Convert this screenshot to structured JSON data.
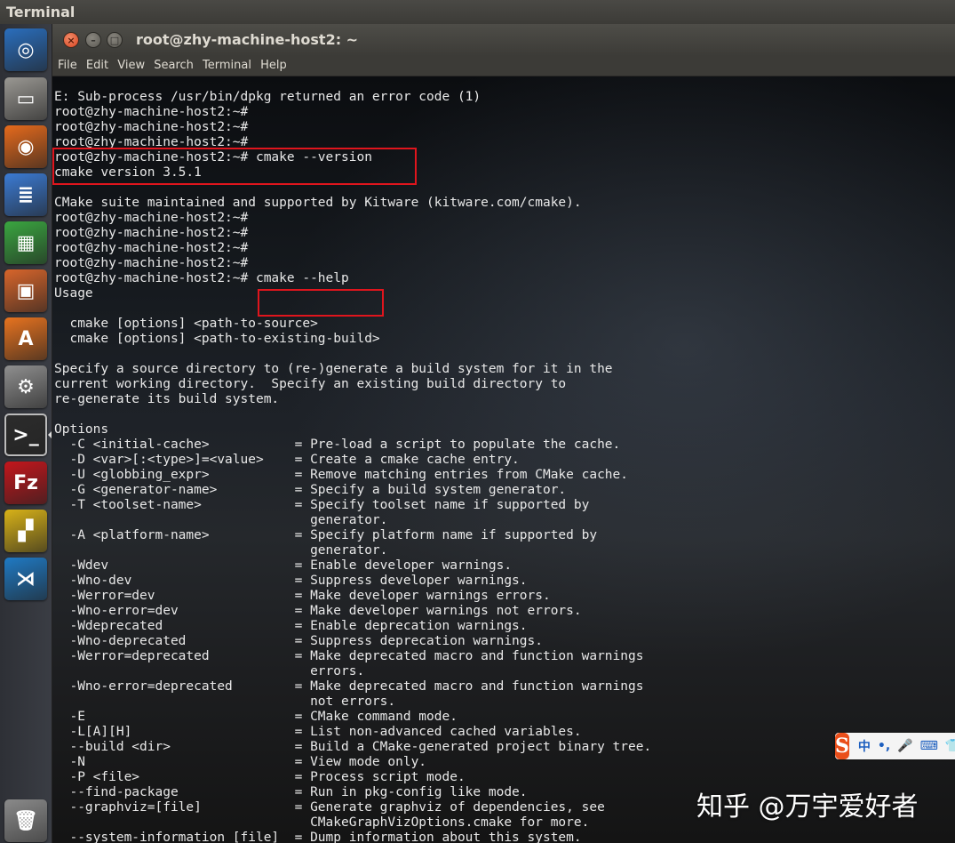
{
  "top_panel": {
    "title": "Terminal"
  },
  "launcher": {
    "items": [
      {
        "name": "ubuntu-dash-icon",
        "glyph": "◎",
        "color": "#2a6ebd"
      },
      {
        "name": "files-icon",
        "glyph": "▭",
        "color": "#9a9893"
      },
      {
        "name": "firefox-icon",
        "glyph": "◉",
        "color": "#e66a1c"
      },
      {
        "name": "writer-icon",
        "glyph": "≣",
        "color": "#3b7bd4"
      },
      {
        "name": "calc-icon",
        "glyph": "▦",
        "color": "#3aa640"
      },
      {
        "name": "impress-icon",
        "glyph": "▣",
        "color": "#d8652b"
      },
      {
        "name": "software-center-icon",
        "glyph": "A",
        "color": "#e8731f"
      },
      {
        "name": "settings-icon",
        "glyph": "⚙",
        "color": "#8f8f8f"
      },
      {
        "name": "terminal-icon",
        "glyph": ">_",
        "color": "#2c2c2c"
      },
      {
        "name": "filezilla-icon",
        "glyph": "Fz",
        "color": "#c4161c"
      },
      {
        "name": "multicolor-app-icon",
        "glyph": "▞",
        "color": "#d8b218"
      },
      {
        "name": "vscode-icon",
        "glyph": "⋊",
        "color": "#1f7ac4"
      }
    ],
    "trash": {
      "name": "trash-icon",
      "glyph": "🗑",
      "color": "#8a8a8a"
    }
  },
  "window": {
    "title": "root@zhy-machine-host2: ~",
    "buttons": {
      "close": "×",
      "minimize": "–",
      "maximize": "□"
    }
  },
  "menubar": [
    "File",
    "Edit",
    "View",
    "Search",
    "Terminal",
    "Help"
  ],
  "terminal": {
    "lines": [
      "E: Sub-process /usr/bin/dpkg returned an error code (1)",
      "root@zhy-machine-host2:~#",
      "root@zhy-machine-host2:~#",
      "root@zhy-machine-host2:~#",
      "root@zhy-machine-host2:~# cmake --version",
      "cmake version 3.5.1",
      "",
      "CMake suite maintained and supported by Kitware (kitware.com/cmake).",
      "root@zhy-machine-host2:~#",
      "root@zhy-machine-host2:~#",
      "root@zhy-machine-host2:~#",
      "root@zhy-machine-host2:~#",
      "root@zhy-machine-host2:~# cmake --help",
      "Usage",
      "",
      "  cmake [options] <path-to-source>",
      "  cmake [options] <path-to-existing-build>",
      "",
      "Specify a source directory to (re-)generate a build system for it in the",
      "current working directory.  Specify an existing build directory to",
      "re-generate its build system.",
      "",
      "Options",
      "  -C <initial-cache>           = Pre-load a script to populate the cache.",
      "  -D <var>[:<type>]=<value>    = Create a cmake cache entry.",
      "  -U <globbing_expr>           = Remove matching entries from CMake cache.",
      "  -G <generator-name>          = Specify a build system generator.",
      "  -T <toolset-name>            = Specify toolset name if supported by",
      "                                 generator.",
      "  -A <platform-name>           = Specify platform name if supported by",
      "                                 generator.",
      "  -Wdev                        = Enable developer warnings.",
      "  -Wno-dev                     = Suppress developer warnings.",
      "  -Werror=dev                  = Make developer warnings errors.",
      "  -Wno-error=dev               = Make developer warnings not errors.",
      "  -Wdeprecated                 = Enable deprecation warnings.",
      "  -Wno-deprecated              = Suppress deprecation warnings.",
      "  -Werror=deprecated           = Make deprecated macro and function warnings",
      "                                 errors.",
      "  -Wno-error=deprecated        = Make deprecated macro and function warnings",
      "                                 not errors.",
      "  -E                           = CMake command mode.",
      "  -L[A][H]                     = List non-advanced cached variables.",
      "  --build <dir>                = Build a CMake-generated project binary tree.",
      "  -N                           = View mode only.",
      "  -P <file>                    = Process script mode.",
      "  --find-package               = Run in pkg-config like mode.",
      "  --graphviz=[file]            = Generate graphviz of dependencies, see",
      "                                 CMakeGraphVizOptions.cmake for more.",
      "  --system-information [file]  = Dump information about this system."
    ],
    "highlight_color": "#e0151d"
  },
  "ime": {
    "logo": "S",
    "parts": [
      "中",
      "•,",
      "🎤",
      "⌨",
      "👕"
    ]
  },
  "watermark": "知乎 @万宇爱好者"
}
